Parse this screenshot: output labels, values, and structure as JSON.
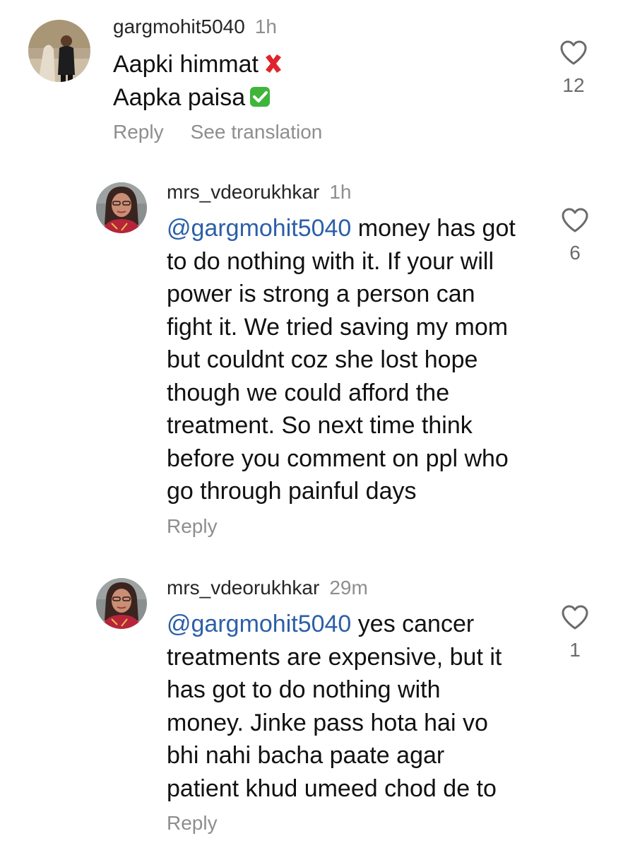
{
  "colors": {
    "username": "#262626",
    "meta": "#8e8e8e",
    "mention": "#2c5fa8",
    "text": "#111111",
    "heart": "#6b6b6b",
    "cross": "#e0242c",
    "check_bg": "#3fb53a"
  },
  "comments": [
    {
      "username": "gargmohit5040",
      "time": "1h",
      "lines": [
        "Aapki himmat",
        "Aapka paisa"
      ],
      "emojis": [
        "cross-mark-icon",
        "check-mark-icon"
      ],
      "actions": {
        "reply": "Reply",
        "translate": "See translation"
      },
      "likes": "12"
    },
    {
      "username": "mrs_vdeorukhkar",
      "time": "1h",
      "mention": "@gargmohit5040",
      "lines": [
        " money has got",
        "to do nothing with it. If your will",
        "power is strong a person can",
        "fight it. We tried saving my mom",
        "but couldnt coz she lost hope",
        "though we could afford the",
        "treatment. So next time think",
        "before you comment on ppl who",
        "go through painful days"
      ],
      "actions": {
        "reply": "Reply"
      },
      "likes": "6"
    },
    {
      "username": "mrs_vdeorukhkar",
      "time": "29m",
      "mention": "@gargmohit5040",
      "lines": [
        " yes cancer",
        "treatments are expensive, but it",
        "has got to do nothing with",
        "money. Jinke pass hota hai vo",
        "bhi nahi bacha paate agar",
        "patient khud umeed chod de to"
      ],
      "actions": {
        "reply": "Reply"
      },
      "likes": "1"
    }
  ]
}
